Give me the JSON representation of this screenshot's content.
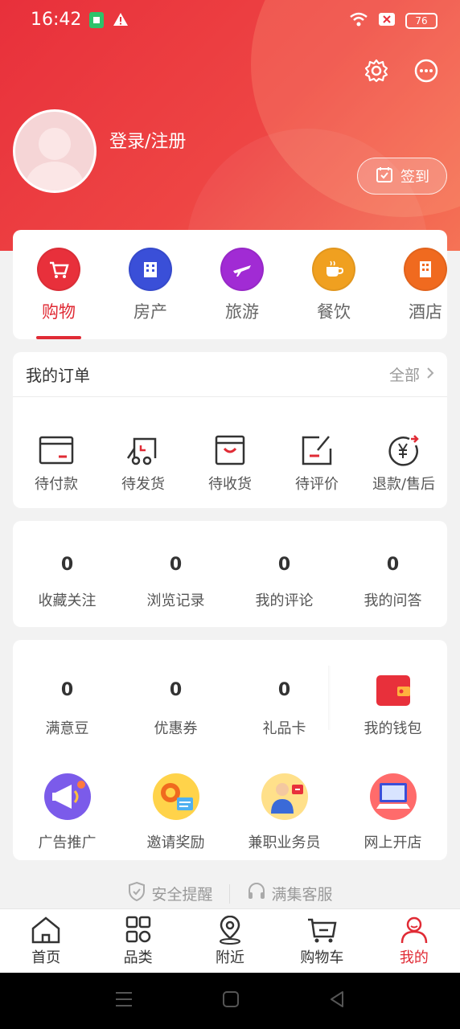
{
  "status_bar": {
    "time": "16:42",
    "battery": "76"
  },
  "header": {
    "login_label": "登录/注册",
    "checkin_label": "签到"
  },
  "categories": [
    {
      "label": "购物",
      "color": "#e8303b",
      "icon": "cart-icon",
      "active": true
    },
    {
      "label": "房产",
      "color": "#3a4fd8",
      "icon": "building-icon",
      "active": false
    },
    {
      "label": "旅游",
      "color": "#a12bd4",
      "icon": "plane-icon",
      "active": false
    },
    {
      "label": "餐饮",
      "color": "#f0a020",
      "icon": "coffee-icon",
      "active": false
    },
    {
      "label": "酒店",
      "color": "#f06a1f",
      "icon": "hotel-icon",
      "active": false
    }
  ],
  "orders": {
    "title": "我的订单",
    "all_label": "全部",
    "items": [
      {
        "label": "待付款",
        "icon": "wallet-card-icon"
      },
      {
        "label": "待发货",
        "icon": "delivery-cart-icon"
      },
      {
        "label": "待收货",
        "icon": "receive-box-icon"
      },
      {
        "label": "待评价",
        "icon": "review-edit-icon"
      },
      {
        "label": "退款/售后",
        "icon": "refund-yen-icon"
      }
    ]
  },
  "stats": [
    {
      "num": "0",
      "label": "收藏关注"
    },
    {
      "num": "0",
      "label": "浏览记录"
    },
    {
      "num": "0",
      "label": "我的评论"
    },
    {
      "num": "0",
      "label": "我的问答"
    }
  ],
  "wallet": {
    "items": [
      {
        "num": "0",
        "label": "满意豆"
      },
      {
        "num": "0",
        "label": "优惠券"
      },
      {
        "num": "0",
        "label": "礼品卡"
      }
    ],
    "wallet_label": "我的钱包"
  },
  "tools": [
    {
      "label": "广告推广",
      "icon": "megaphone-icon"
    },
    {
      "label": "邀请奖励",
      "icon": "invite-reward-icon"
    },
    {
      "label": "兼职业务员",
      "icon": "salesperson-icon"
    },
    {
      "label": "网上开店",
      "icon": "online-store-icon"
    }
  ],
  "footer": {
    "safety": "安全提醒",
    "service": "满集客服"
  },
  "tabbar": [
    {
      "label": "首页",
      "active": false
    },
    {
      "label": "品类",
      "active": false
    },
    {
      "label": "附近",
      "active": false
    },
    {
      "label": "购物车",
      "active": false
    },
    {
      "label": "我的",
      "active": true
    }
  ],
  "colors": {
    "accent": "#e02b35",
    "header_start": "#e8303b",
    "header_end": "#f57356"
  }
}
